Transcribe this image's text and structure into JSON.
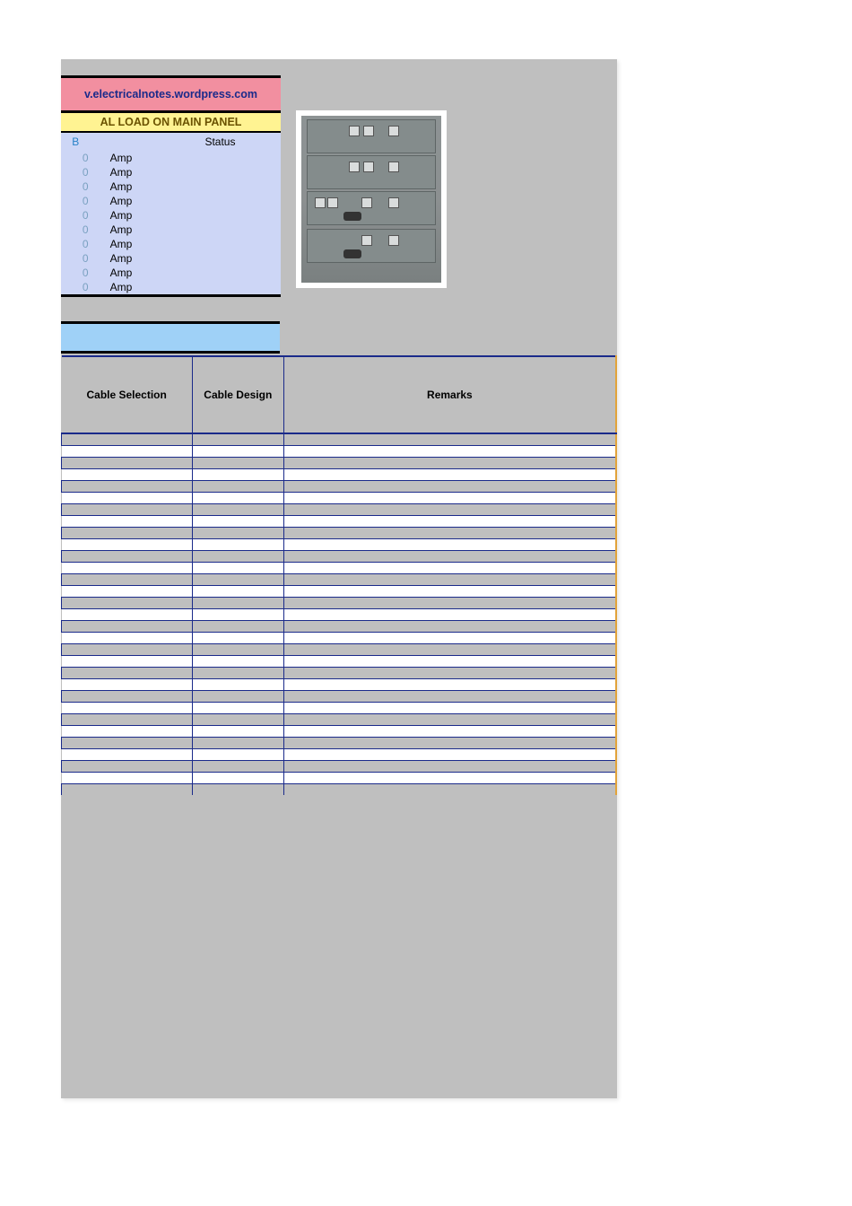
{
  "header": {
    "site_link_text": "v.electricalnotes.wordpress.com"
  },
  "load_panel": {
    "title": "AL LOAD ON MAIN PANEL",
    "col_B": "B",
    "col_Status": "Status",
    "unit": "Amp",
    "rows": [
      {
        "b": "0"
      },
      {
        "b": "0"
      },
      {
        "b": "0"
      },
      {
        "b": "0"
      },
      {
        "b": "0"
      },
      {
        "b": "0"
      },
      {
        "b": "0"
      },
      {
        "b": "0"
      },
      {
        "b": "0"
      },
      {
        "b": "0"
      }
    ]
  },
  "bottom_table": {
    "headers": {
      "c1": "Cable Selection",
      "c2": "Cable Design",
      "c3": "Remarks"
    },
    "row_count": 15
  }
}
